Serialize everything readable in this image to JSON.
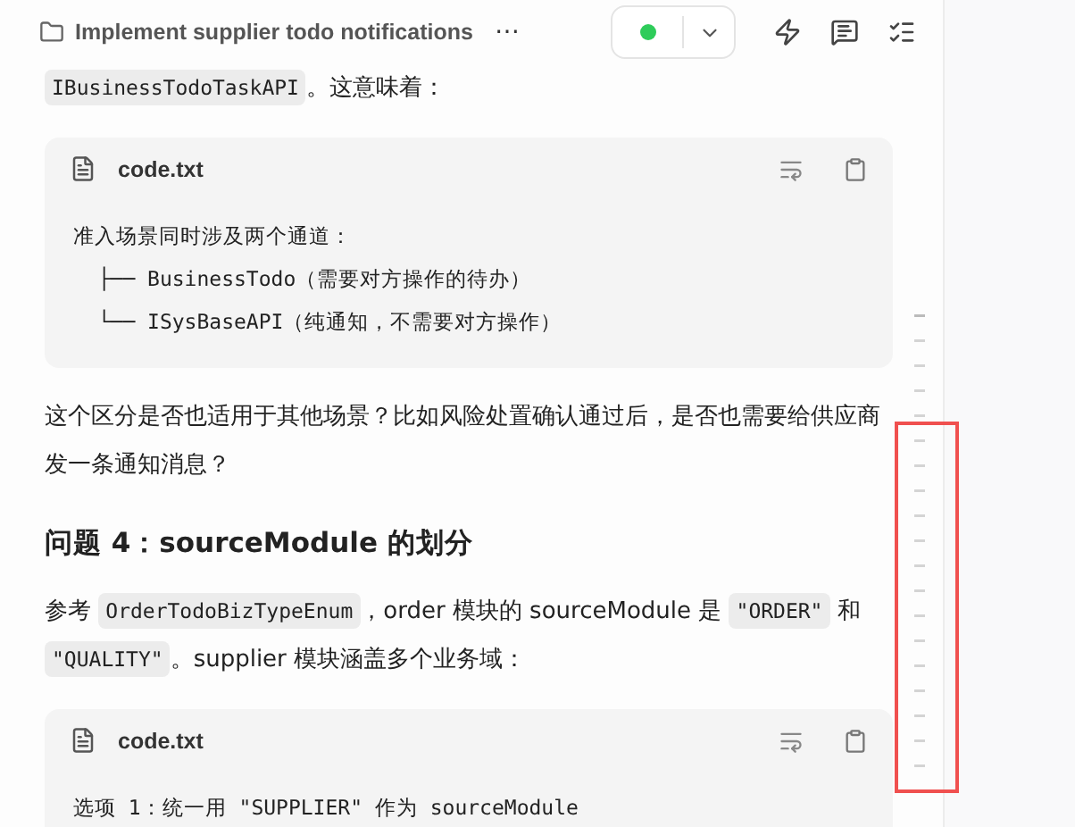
{
  "header": {
    "title": "Implement supplier todo notifications",
    "more": "⋯"
  },
  "content": [
    {
      "kind": "para",
      "parts": [
        {
          "code": true,
          "text": "IBusinessTodoTaskAPI"
        },
        {
          "code": false,
          "text": "。这意味着："
        }
      ]
    },
    {
      "kind": "code",
      "filename": "code.txt",
      "lines": [
        "准入场景同时涉及两个通道：",
        "  ├── BusinessTodo（需要对方操作的待办）",
        "  └── ISysBaseAPI（纯通知，不需要对方操作）"
      ]
    },
    {
      "kind": "para",
      "parts": [
        {
          "code": false,
          "text": "这个区分是否也适用于其他场景？比如风险处置确认通过后，是否也需要给供应商发一条通知消息？"
        }
      ]
    },
    {
      "kind": "heading",
      "text": "问题 4：sourceModule 的划分"
    },
    {
      "kind": "para",
      "parts": [
        {
          "code": false,
          "text": "参考 "
        },
        {
          "code": true,
          "text": "OrderTodoBizTypeEnum"
        },
        {
          "code": false,
          "text": "，order 模块的 sourceModule 是 "
        },
        {
          "code": true,
          "text": "\"ORDER\""
        },
        {
          "code": false,
          "text": " 和 "
        },
        {
          "code": true,
          "text": "\"QUALITY\""
        },
        {
          "code": false,
          "text": "。supplier 模块涵盖多个业务域："
        }
      ]
    },
    {
      "kind": "code",
      "filename": "code.txt",
      "lines": [
        "选项 1：统一用 \"SUPPLIER\" 作为 sourceModule"
      ]
    }
  ],
  "highlight": {
    "shown": true
  }
}
